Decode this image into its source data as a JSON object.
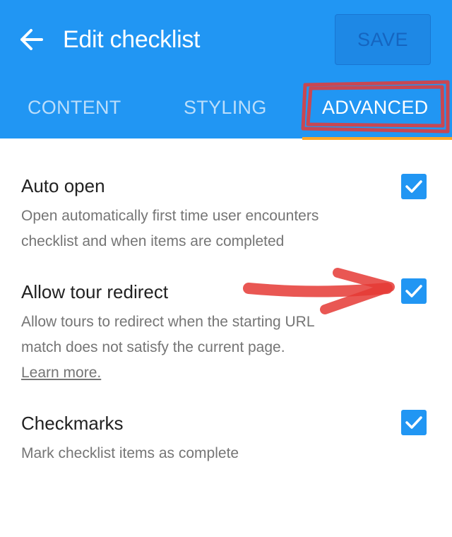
{
  "header": {
    "title": "Edit checklist",
    "save_label": "SAVE",
    "back_icon": "arrow-left-icon"
  },
  "tabs": [
    {
      "label": "CONTENT",
      "active": false
    },
    {
      "label": "STYLING",
      "active": false
    },
    {
      "label": "ADVANCED",
      "active": true
    }
  ],
  "settings": [
    {
      "title": "Auto open",
      "description_lines": [
        "Open automatically first time user encounters",
        "checklist and when items are completed"
      ],
      "checked": true
    },
    {
      "title": "Allow tour redirect",
      "description_lines": [
        "Allow tours to redirect when the starting URL",
        "match does not satisfy the current page."
      ],
      "link": "Learn more.",
      "checked": true
    },
    {
      "title": "Checkmarks",
      "description_lines": [
        "Mark checklist items as complete"
      ],
      "checked": true
    }
  ],
  "colors": {
    "primary": "#2196f3",
    "tab_indicator": "#ffa726",
    "annotation": "#e53935",
    "checkbox": "#2196f3"
  }
}
